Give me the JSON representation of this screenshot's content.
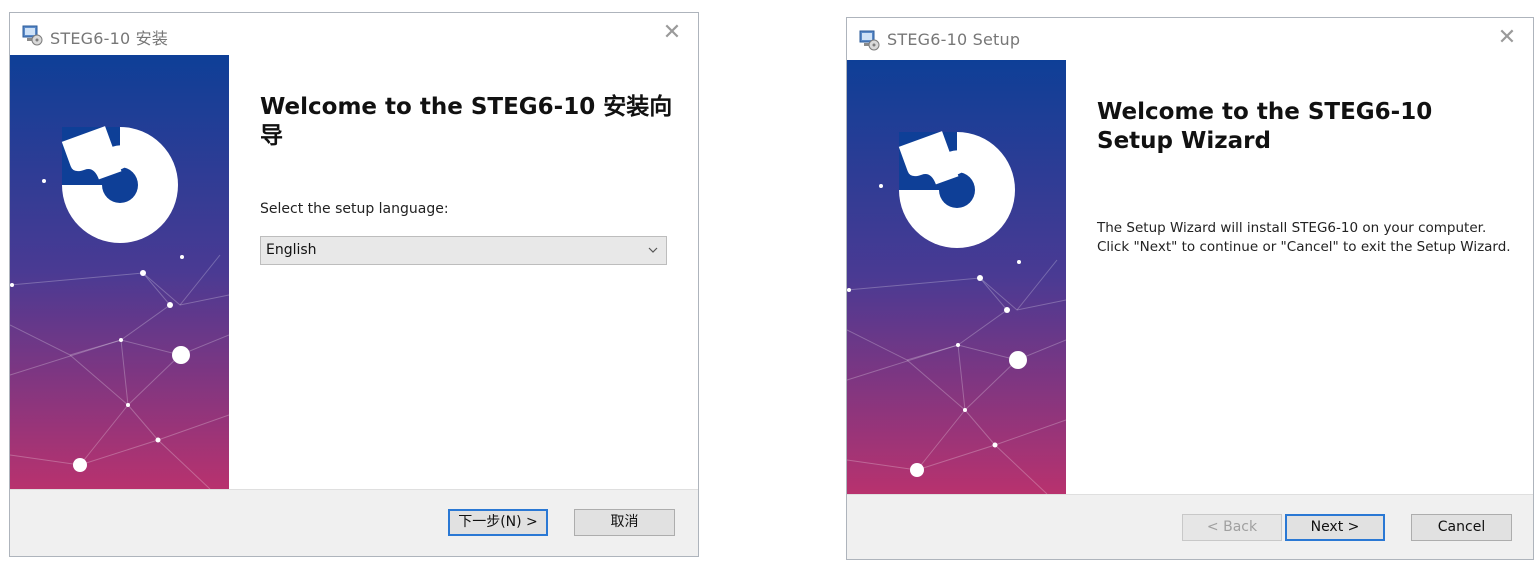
{
  "installer_cn": {
    "title": "STEG6-10 安装",
    "heading": "Welcome to the STEG6-10 安装向导",
    "language_label": "Select the setup language:",
    "language_selected": "English",
    "next_label": "下一步(N) >",
    "cancel_label": "取消"
  },
  "installer_en": {
    "title": "STEG6-10 Setup",
    "heading": "Welcome to the STEG6-10 Setup Wizard",
    "description_line1": "The Setup Wizard will install STEG6-10 on your computer.",
    "description_line2": "Click \"Next\" to continue or \"Cancel\" to exit the Setup Wizard.",
    "back_label": "< Back",
    "next_label": "Next >",
    "cancel_label": "Cancel"
  },
  "icons": {
    "close": "close-icon",
    "app": "installer-app-icon",
    "dropdown": "chevron-down-icon",
    "logo": "puzzle-logo"
  },
  "colors": {
    "banner_top": "#0e3f97",
    "banner_mid": "#4a3a93",
    "banner_bottom": "#b8326e",
    "primary_button_border": "#2a78d4"
  }
}
